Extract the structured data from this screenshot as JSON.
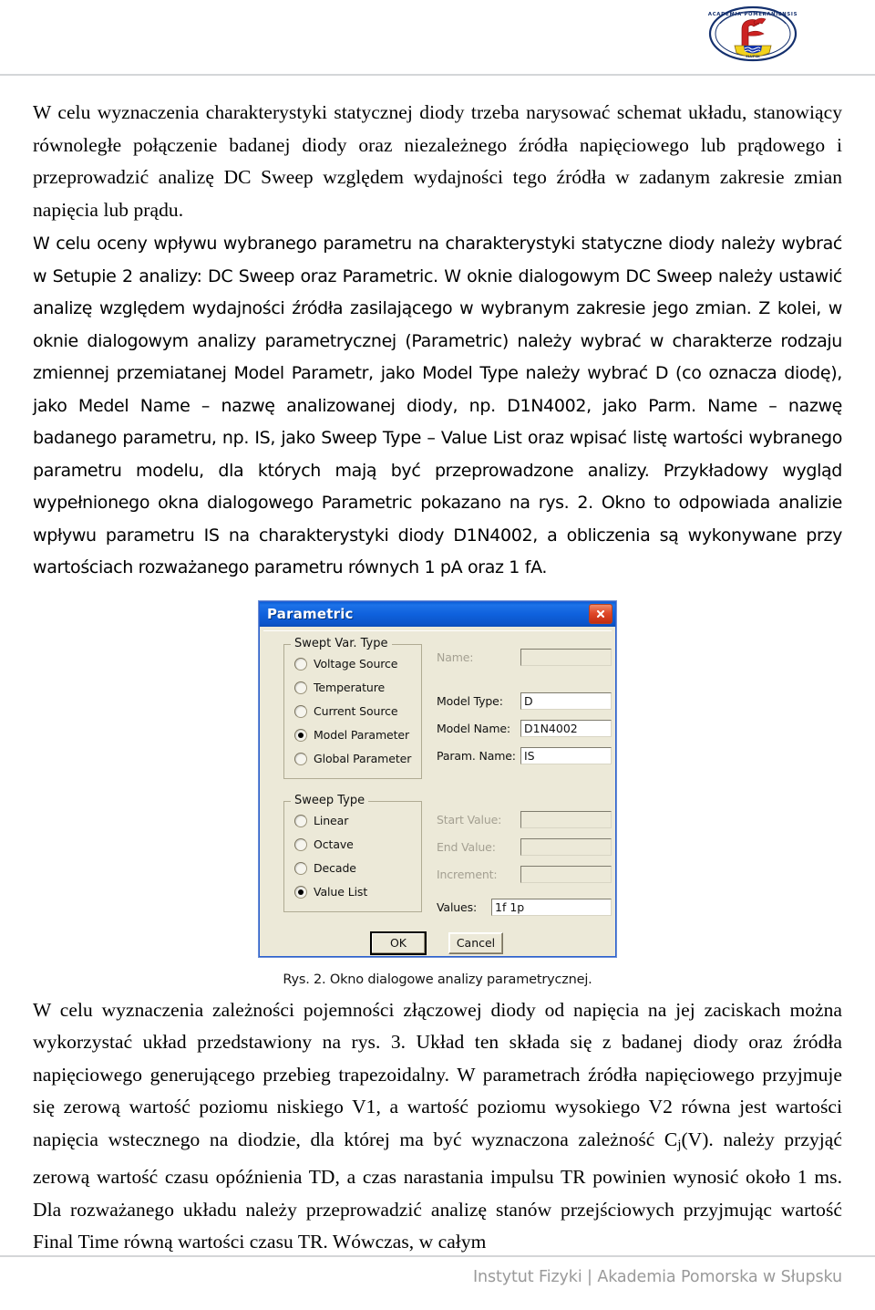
{
  "header": {
    "logo_alt": "Akademia Pomeraniensis crest",
    "logo_motto": "ACADEMIA POMERANIENSIS"
  },
  "document": {
    "paragraphs": [
      {
        "id": "p1",
        "style": "serif",
        "text": "W celu wyznaczenia charakterystyki statycznej diody trzeba narysować schemat układu, stanowiący równoległe połączenie badanej diody oraz niezależnego źródła napięciowego lub prądowego i przeprowadzić analizę DC Sweep względem wydajności tego źródła w zadanym zakresie zmian napięcia lub prądu."
      },
      {
        "id": "p2",
        "style": "sans",
        "text_before_sub": "W celu oceny wpływu wybranego parametru na charakterystyki statyczne diody należy wybrać w Setupie 2 analizy: DC Sweep oraz Parametric. W oknie dialogowym DC Sweep należy ustawić analizę względem wydajności źródła zasilającego w wybranym zakresie jego zmian. Z kolei, w oknie dialogowym analizy parametrycznej (Parametric) należy wybrać w charakterze rodzaju zmiennej przemiatanej Model Parametr, jako Model Type należy wybrać D (co oznacza diodę), jako Medel Name – nazwę analizowanej diody, np. D1N4002, jako Parm. Name – nazwę badanego parametru, np. IS, jako Sweep Type – Value List oraz wpisać listę wartości wybranego parametru modelu, dla których mają być przeprowadzone analizy. Przykładowy wygląd wypełnionego okna dialogowego Parametric pokazano na rys. 2. Okno to odpowiada analizie wpływu parametru IS na charakterystyki diody D1N4002, a obliczenia są wykonywane przy wartościach rozważanego parametru równych 1 pA oraz 1 fA."
      }
    ],
    "paragraph3_parts": {
      "a": "W celu wyznaczenia zależności pojemności złączowej diody od napięcia na jej zaciskach można wykorzystać układ przedstawiony na rys. 3. Układ ten składa się z badanej diody oraz źródła napięciowego generującego przebieg trapezoidalny. W parametrach źródła napięciowego przyjmuje się zerową wartość poziomu niskiego V1, a wartość poziomu wysokiego V2 równa jest wartości napięcia wstecznego na diodzie, dla której ma być wyznaczona zależność C",
      "sub": "j",
      "b": "(V). należy przyjąć zerową wartość czasu opóźnienia TD, a czas narastania impulsu TR powinien wynosić około 1 ms. Dla rozważanego układu należy przeprowadzić analizę stanów przejściowych przyjmując wartość Final Time równą wartości czasu TR. Wówczas, w całym"
    }
  },
  "figure": {
    "caption": "Rys. 2. Okno dialogowe analizy parametrycznej.",
    "dialog": {
      "title": "Parametric",
      "close_label": "×",
      "groups": {
        "swept_var_type": {
          "legend": "Swept Var. Type",
          "options": [
            {
              "label": "Voltage Source",
              "checked": false
            },
            {
              "label": "Temperature",
              "checked": false
            },
            {
              "label": "Current Source",
              "checked": false
            },
            {
              "label": "Model Parameter",
              "checked": true
            },
            {
              "label": "Global Parameter",
              "checked": false
            }
          ]
        },
        "sweep_type": {
          "legend": "Sweep Type",
          "options": [
            {
              "label": "Linear",
              "checked": false
            },
            {
              "label": "Octave",
              "checked": false
            },
            {
              "label": "Decade",
              "checked": false
            },
            {
              "label": "Value List",
              "checked": true
            }
          ]
        }
      },
      "fields": [
        {
          "label": "Name:",
          "value": "",
          "disabled": true
        },
        {
          "label": "Model Type:",
          "value": "D",
          "disabled": false
        },
        {
          "label": "Model Name:",
          "value": "D1N4002",
          "disabled": false
        },
        {
          "label": "Param. Name:",
          "value": "IS",
          "disabled": false
        },
        {
          "label": "Start Value:",
          "value": "",
          "disabled": true
        },
        {
          "label": "End Value:",
          "value": "",
          "disabled": true
        },
        {
          "label": "Increment:",
          "value": "",
          "disabled": true
        },
        {
          "label": "Values:",
          "value": "1f 1p",
          "disabled": false
        }
      ],
      "buttons": {
        "ok": "OK",
        "cancel": "Cancel"
      }
    }
  },
  "footer": {
    "text": "Instytut Fizyki | Akademia Pomorska w Słupsku"
  },
  "colors": {
    "titlebar_blue": "#0f61dd",
    "dialog_face": "#ece9d8",
    "close_red": "#e0492a",
    "rule_gray": "#d4d6d8",
    "footer_text": "#9a9a9a"
  }
}
